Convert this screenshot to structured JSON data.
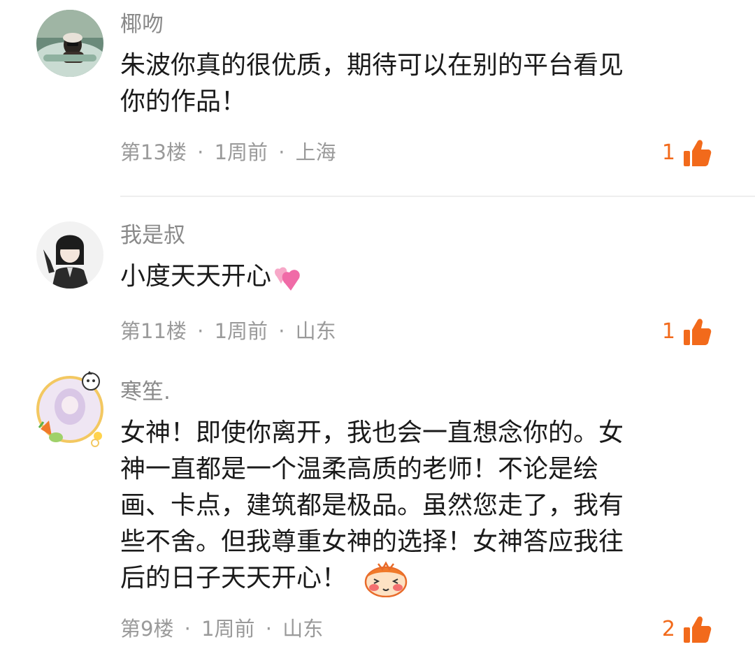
{
  "accent_color": "#f26a1b",
  "comments": [
    {
      "username": "椰吻",
      "lines": [
        "朱波你真的很优质，期待可以在别的平台看见",
        "你的作品！"
      ],
      "floor": "第13楼",
      "time": "1周前",
      "location": "上海",
      "likes": "1",
      "avatar": "avatar-girl-in-car"
    },
    {
      "username": "我是叔",
      "lines": [
        "小度天天开心"
      ],
      "emoji": "two-hearts-emoji",
      "floor": "第11楼",
      "time": "1周前",
      "location": "山东",
      "likes": "1",
      "avatar": "avatar-anime-girl"
    },
    {
      "username": "寒笙.",
      "lines": [
        "女神！即使你离开，我也会一直想念你的。女",
        "神一直都是一个温柔高质的老师！不论是绘",
        "画、卡点，建筑都是极品。虽然您走了，我有",
        "些不舍。但我尊重女神的选择！女神答应我往",
        "后的日子天天开心！"
      ],
      "emoji": "blushing-face-emoji",
      "floor": "第9楼",
      "time": "1周前",
      "location": "山东",
      "likes": "2",
      "avatar": "avatar-flower-frame"
    }
  ],
  "separator": "·"
}
